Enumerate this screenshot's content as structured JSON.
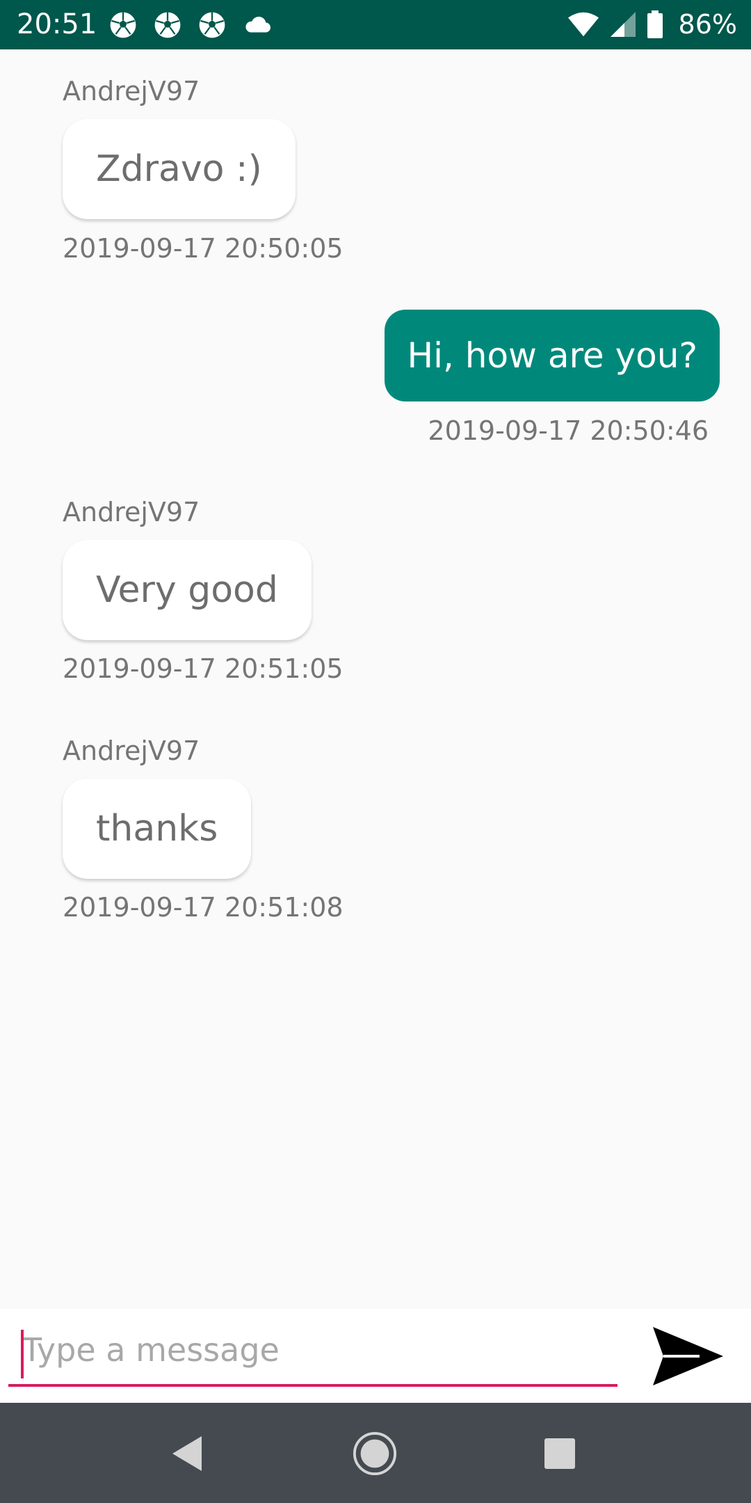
{
  "status_bar": {
    "time": "20:51",
    "notification_icons": [
      "soccer-ball-icon",
      "soccer-ball-icon",
      "soccer-ball-icon",
      "cloud-icon"
    ],
    "battery_percent": "86%",
    "background": "#00574b"
  },
  "chat": {
    "messages": [
      {
        "direction": "incoming",
        "sender": "AndrejV97",
        "text": "Zdravo :)",
        "timestamp": "2019-09-17 20:50:05"
      },
      {
        "direction": "outgoing",
        "text": "Hi, how are you?",
        "timestamp": "2019-09-17 20:50:46"
      },
      {
        "direction": "incoming",
        "sender": "AndrejV97",
        "text": "Very good",
        "timestamp": "2019-09-17 20:51:05"
      },
      {
        "direction": "incoming",
        "sender": "AndrejV97",
        "text": "thanks",
        "timestamp": "2019-09-17 20:51:08"
      }
    ]
  },
  "composer": {
    "placeholder": "Type a message",
    "value": "",
    "send_icon": "send-icon",
    "accent": "#d81b60"
  },
  "colors": {
    "outgoing_bubble": "#00897b",
    "incoming_bubble": "#ffffff"
  },
  "nav_bar": {
    "icons": [
      "back-icon",
      "home-icon",
      "recents-icon"
    ]
  }
}
